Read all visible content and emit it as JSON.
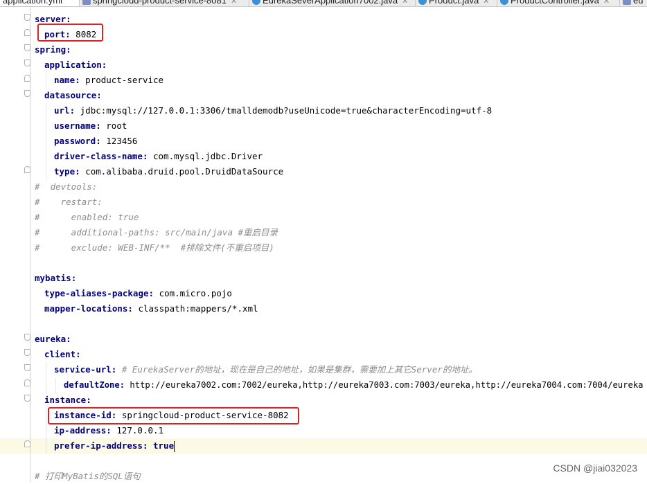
{
  "tabs": [
    {
      "label": "application.yml",
      "active": true,
      "icon": "yml-file-icon"
    },
    {
      "label": "springcloud-product-service-8081",
      "active": false,
      "icon": "module-icon"
    },
    {
      "label": "EurekaSeverApplication7002.java",
      "active": false,
      "icon": "class-icon"
    },
    {
      "label": "Product.java",
      "active": false,
      "icon": "class-icon"
    },
    {
      "label": "ProductController.java",
      "active": false,
      "icon": "class-icon"
    },
    {
      "label": "eu",
      "active": false,
      "icon": "module-icon"
    }
  ],
  "code": {
    "l1_key": "server",
    "l2_key": "port",
    "l2_val": "8082",
    "l3_key": "spring",
    "l4_key": "application",
    "l5_key": "name",
    "l5_val": "product-service",
    "l6_key": "datasource",
    "l7_key": "url",
    "l7_val": "jdbc:mysql://127.0.0.1:3306/tmalldemodb?useUnicode=true&characterEncoding=utf-8",
    "l8_key": "username",
    "l8_val": "root",
    "l9_key": "password",
    "l9_val": "123456",
    "l10_key": "driver-class-name",
    "l10_val": "com.mysql.jdbc.Driver",
    "l11_key": "type",
    "l11_val": "com.alibaba.druid.pool.DruidDataSource",
    "l12": "#  devtools:",
    "l13": "#    restart:",
    "l14": "#      enabled: true",
    "l15": "#      additional-paths: src/main/java #重启目录",
    "l16": "#      exclude: WEB-INF/**  #排除文件(不重启项目)",
    "l18_key": "mybatis",
    "l19_key": "type-aliases-package",
    "l19_val": "com.micro.pojo",
    "l20_key": "mapper-locations",
    "l20_val": "classpath:mappers/*.xml",
    "l22_key": "eureka",
    "l23_key": "client",
    "l24_key": "service-url",
    "l24_comment": "# EurekaServer的地址，现在是自己的地址，如果是集群，需要加上其它Server的地址。",
    "l25_key": "defaultZone",
    "l25_val": "http://eureka7002.com:7002/eureka,http://eureka7003.com:7003/eureka,http://eureka7004.com:7004/eureka",
    "l26_key": "instance",
    "l27_key": "instance-id",
    "l27_val": "springcloud-product-service-8082",
    "l28_key": "ip-address",
    "l28_val": "127.0.0.1",
    "l29_key": "prefer-ip-address",
    "l29_val": "true",
    "l31": "# 打印MyBatis的SQL语句"
  },
  "watermark": "CSDN @jiai032023",
  "colors": {
    "key": "#000080",
    "comment": "#8c8c8c",
    "highlight_box": "#e02020",
    "caret_line": "#fcfae4"
  }
}
